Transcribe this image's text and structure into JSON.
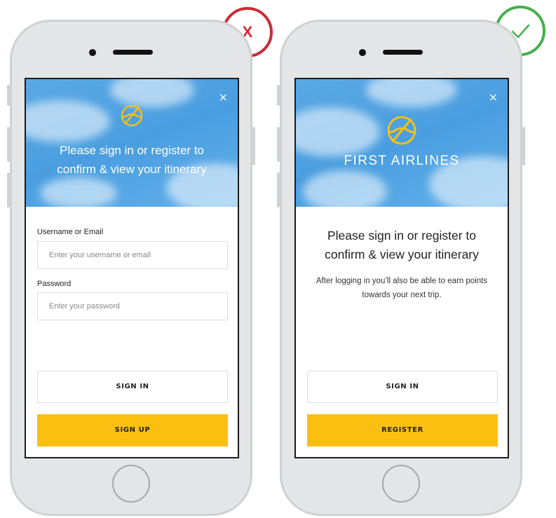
{
  "bad_badge": {
    "mark": "X",
    "color": "#cc2b36"
  },
  "good_badge": {
    "icon": "check-icon",
    "color": "#46b04c"
  },
  "left_screen": {
    "close": "×",
    "hero_line1": "Please sign in or register to",
    "hero_line2": "confirm & view your itinerary",
    "username_label": "Username or Email",
    "username_placeholder": "Enter your username or email",
    "password_label": "Password",
    "password_placeholder": "Enter your password",
    "sign_in": "SIGN IN",
    "sign_up": "SIGN UP"
  },
  "right_screen": {
    "close": "×",
    "brand": "FIRST AIRLINES",
    "title_line1": "Please sign in or register to",
    "title_line2": "confirm & view your itinerary",
    "sub_line1": "After logging in you’ll also be able to earn points",
    "sub_line2": "towards your next trip.",
    "sign_in": "SIGN IN",
    "register": "REGISTER"
  },
  "colors": {
    "accent_yellow": "#fbbf12",
    "sky_blue": "#4a9ee0",
    "logo_yellow": "#f5c010"
  }
}
